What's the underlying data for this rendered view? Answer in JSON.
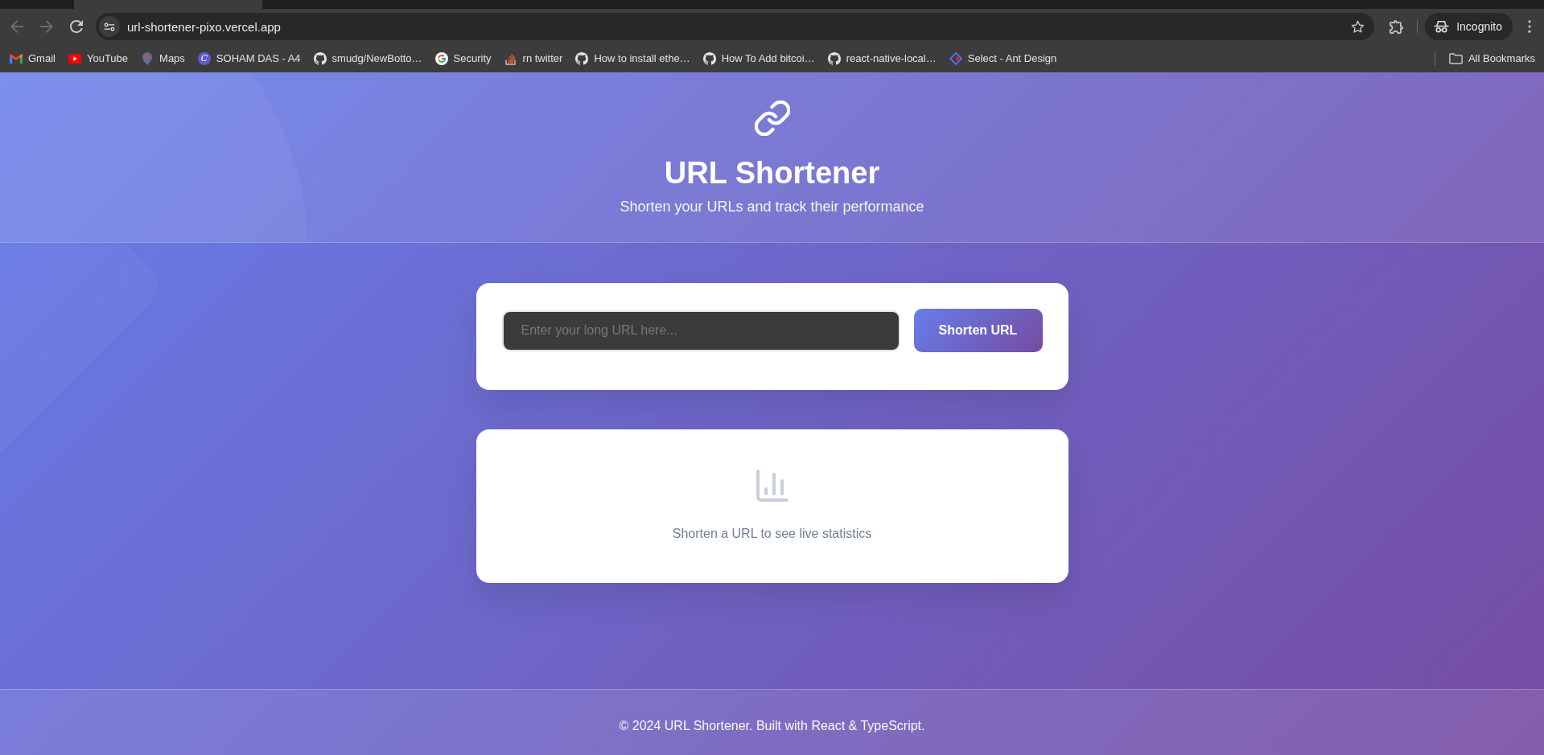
{
  "browser": {
    "navigation": [
      {
        "kind": "back",
        "disabled": true
      },
      {
        "kind": "forward",
        "disabled": true
      },
      {
        "kind": "reload",
        "disabled": false
      }
    ],
    "address": "url-shortener-pixo.vercel.app",
    "profile": "Incognito",
    "bookmarks": [
      {
        "kind": "mail",
        "label": "Gmail"
      },
      {
        "kind": "video",
        "label": "YouTube"
      },
      {
        "kind": "pin",
        "label": "Maps"
      },
      {
        "kind": "letter",
        "logo_text": "C",
        "label": "SOHAM DAS - A4"
      },
      {
        "kind": "github",
        "label": "smudg/NewBotto…"
      },
      {
        "kind": "search",
        "label": "Security"
      },
      {
        "kind": "stack",
        "label": "rn twitter"
      },
      {
        "kind": "github",
        "label": "How to install ethe…"
      },
      {
        "kind": "github",
        "label": "How To Add bitcoi…"
      },
      {
        "kind": "github",
        "label": "react-native-local…"
      },
      {
        "kind": "diamond",
        "label": "Select - Ant Design"
      }
    ],
    "all_bookmarks": "All Bookmarks"
  },
  "header": {
    "title": "URL Shortener",
    "subtitle": "Shorten your URLs and track their performance"
  },
  "shorten_form": {
    "url_field": {
      "placeholder": "Enter your long URL here..."
    },
    "button": "Shorten URL"
  },
  "stats": {
    "message": "Shorten a URL to see live statistics"
  },
  "footer": {
    "text": "© 2024 URL Shortener. Built with React & TypeScript."
  }
}
